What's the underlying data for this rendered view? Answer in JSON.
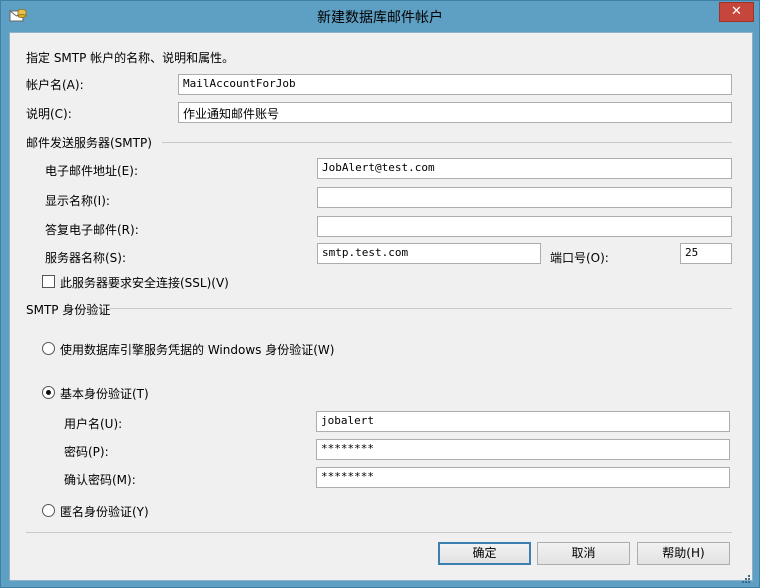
{
  "window": {
    "title": "新建数据库邮件帐户",
    "close_glyph": "✕"
  },
  "intro": "指定 SMTP 帐户的名称、说明和属性。",
  "account": {
    "name_label": "帐户名(A):",
    "name_value": "MailAccountForJob",
    "desc_label": "说明(C):",
    "desc_value": "作业通知邮件账号"
  },
  "smtp_server": {
    "section_label": "邮件发送服务器(SMTP)",
    "email_label": "电子邮件地址(E):",
    "email_value": "JobAlert@test.com",
    "display_label": "显示名称(I):",
    "display_value": "",
    "reply_label": "答复电子邮件(R):",
    "reply_value": "",
    "server_label": "服务器名称(S):",
    "server_value": "smtp.test.com",
    "port_label": "端口号(O):",
    "port_value": "25",
    "ssl_label": "此服务器要求安全连接(SSL)(V)",
    "ssl_checked": false
  },
  "auth": {
    "section_label": "SMTP 身份验证",
    "windows_label": "使用数据库引擎服务凭据的 Windows 身份验证(W)",
    "basic_label": "基本身份验证(T)",
    "username_label": "用户名(U):",
    "username_value": "jobalert",
    "password_label": "密码(P):",
    "password_value": "********",
    "confirm_label": "确认密码(M):",
    "confirm_value": "********",
    "anonymous_label": "匿名身份验证(Y)",
    "selected": "basic"
  },
  "buttons": {
    "ok": "确定",
    "cancel": "取消",
    "help": "帮助(H)"
  },
  "icons": {
    "app": "database-mail-icon",
    "close": "close-icon",
    "grip": "resize-grip-icon"
  },
  "colors": {
    "titlebar": "#5ea0c4",
    "close": "#c7463b",
    "client": "#f0f0f0",
    "default_button_border": "#3c7fb1"
  }
}
